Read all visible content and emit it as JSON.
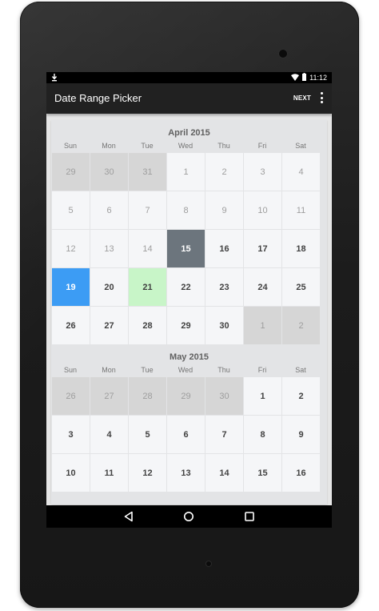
{
  "status_bar": {
    "time": "11:12",
    "icons": [
      "download-icon",
      "wifi-icon",
      "battery-icon"
    ]
  },
  "app_bar": {
    "title": "Date Range Picker",
    "next_label": "NEXT",
    "menu_icon": "overflow-menu-icon"
  },
  "weekdays": [
    "Sun",
    "Mon",
    "Tue",
    "Wed",
    "Thu",
    "Fri",
    "Sat"
  ],
  "months": [
    {
      "title": "April 2015",
      "weeks": [
        [
          {
            "d": "29",
            "s": "other"
          },
          {
            "d": "30",
            "s": "other"
          },
          {
            "d": "31",
            "s": "other"
          },
          {
            "d": "1",
            "s": "disabled"
          },
          {
            "d": "2",
            "s": "disabled"
          },
          {
            "d": "3",
            "s": "disabled"
          },
          {
            "d": "4",
            "s": "disabled"
          }
        ],
        [
          {
            "d": "5",
            "s": "disabled"
          },
          {
            "d": "6",
            "s": "disabled"
          },
          {
            "d": "7",
            "s": "disabled"
          },
          {
            "d": "8",
            "s": "disabled"
          },
          {
            "d": "9",
            "s": "disabled"
          },
          {
            "d": "10",
            "s": "disabled"
          },
          {
            "d": "11",
            "s": "disabled"
          }
        ],
        [
          {
            "d": "12",
            "s": "disabled"
          },
          {
            "d": "13",
            "s": "disabled"
          },
          {
            "d": "14",
            "s": "disabled"
          },
          {
            "d": "15",
            "s": "today"
          },
          {
            "d": "16",
            "s": "normal"
          },
          {
            "d": "17",
            "s": "normal"
          },
          {
            "d": "18",
            "s": "normal"
          }
        ],
        [
          {
            "d": "19",
            "s": "start"
          },
          {
            "d": "20",
            "s": "normal"
          },
          {
            "d": "21",
            "s": "end"
          },
          {
            "d": "22",
            "s": "normal"
          },
          {
            "d": "23",
            "s": "normal"
          },
          {
            "d": "24",
            "s": "normal"
          },
          {
            "d": "25",
            "s": "normal"
          }
        ],
        [
          {
            "d": "26",
            "s": "normal"
          },
          {
            "d": "27",
            "s": "normal"
          },
          {
            "d": "28",
            "s": "normal"
          },
          {
            "d": "29",
            "s": "normal"
          },
          {
            "d": "30",
            "s": "normal"
          },
          {
            "d": "1",
            "s": "other"
          },
          {
            "d": "2",
            "s": "other"
          }
        ]
      ]
    },
    {
      "title": "May 2015",
      "weeks": [
        [
          {
            "d": "26",
            "s": "other"
          },
          {
            "d": "27",
            "s": "other"
          },
          {
            "d": "28",
            "s": "other"
          },
          {
            "d": "29",
            "s": "other"
          },
          {
            "d": "30",
            "s": "other"
          },
          {
            "d": "1",
            "s": "normal"
          },
          {
            "d": "2",
            "s": "normal"
          }
        ],
        [
          {
            "d": "3",
            "s": "normal"
          },
          {
            "d": "4",
            "s": "normal"
          },
          {
            "d": "5",
            "s": "normal"
          },
          {
            "d": "6",
            "s": "normal"
          },
          {
            "d": "7",
            "s": "normal"
          },
          {
            "d": "8",
            "s": "normal"
          },
          {
            "d": "9",
            "s": "normal"
          }
        ],
        [
          {
            "d": "10",
            "s": "normal"
          },
          {
            "d": "11",
            "s": "normal"
          },
          {
            "d": "12",
            "s": "normal"
          },
          {
            "d": "13",
            "s": "normal"
          },
          {
            "d": "14",
            "s": "normal"
          },
          {
            "d": "15",
            "s": "normal"
          },
          {
            "d": "16",
            "s": "normal"
          }
        ]
      ]
    }
  ],
  "selection": {
    "start_date": "19",
    "end_date": "21",
    "today": "15"
  },
  "colors": {
    "start": "#3c9cf4",
    "end": "#c8f5c8",
    "today": "#6c757d",
    "other_month": "#d6d6d6",
    "app_bar": "#212121"
  },
  "nav_bar": {
    "icons": [
      "back-icon",
      "home-icon",
      "recents-icon"
    ]
  }
}
